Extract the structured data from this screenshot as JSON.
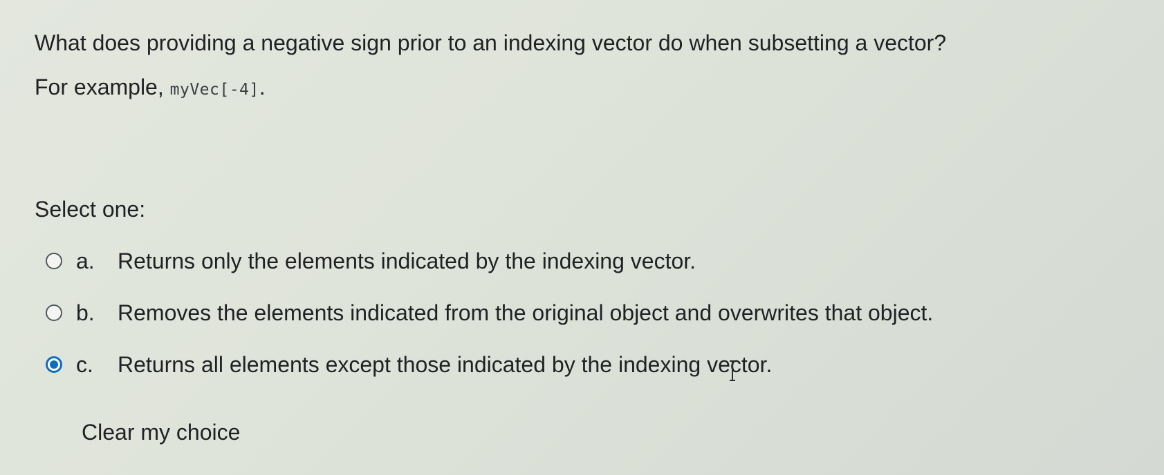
{
  "question": {
    "text": "What does providing a negative sign prior to an indexing vector do when subsetting a vector?",
    "example_prefix": "For example, ",
    "example_code": "myVec[-4]",
    "example_suffix": "."
  },
  "prompt": "Select one:",
  "answers": [
    {
      "letter": "a.",
      "text": "Returns only the elements indicated by the indexing vector.",
      "selected": false
    },
    {
      "letter": "b.",
      "text": "Removes the elements indicated from the original object and overwrites that object.",
      "selected": false
    },
    {
      "letter": "c.",
      "text": "Returns all elements except those indicated by the indexing vector.",
      "selected": true
    }
  ],
  "clear_choice_label": "Clear my choice",
  "colors": {
    "accent": "#0f6cbf",
    "text": "#1f2124",
    "background": "#dfe4da"
  },
  "icons": {
    "radio_unchecked": "radio-unchecked-icon",
    "radio_checked": "radio-checked-icon",
    "cursor": "text-cursor-icon"
  }
}
